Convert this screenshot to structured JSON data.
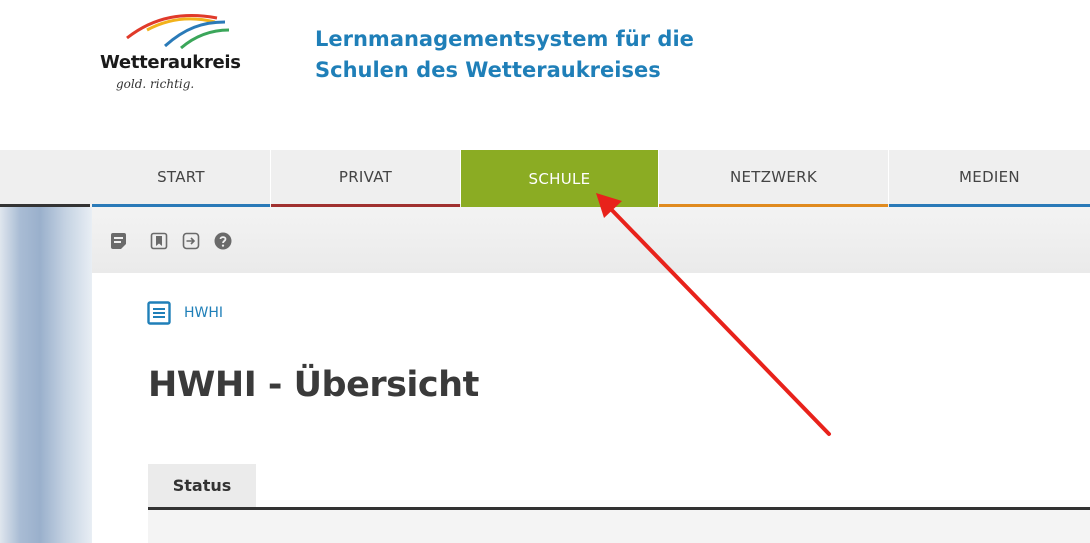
{
  "header": {
    "logo_name": "Wetteraukreis",
    "logo_tagline": "gold. richtig.",
    "site_title_line1": "Lernmanagementsystem für die",
    "site_title_line2": "Schulen des Wetteraukreises"
  },
  "nav": {
    "tabs": [
      {
        "label": "START",
        "accent": "#2a7ab8"
      },
      {
        "label": "PRIVAT",
        "accent": "#a0302f"
      },
      {
        "label": "SCHULE",
        "accent": "#8bac23",
        "active": true
      },
      {
        "label": "NETZWERK",
        "accent": "#e08a1e"
      },
      {
        "label": "MEDIEN",
        "accent": "#2a7ab8"
      }
    ]
  },
  "toolbar": {
    "icons": [
      "notes-icon",
      "bookmark-icon",
      "logout-icon",
      "help-icon"
    ]
  },
  "breadcrumb": {
    "label": "HWHI"
  },
  "page": {
    "title": "HWHI - Übersicht"
  },
  "tabs": {
    "status_label": "Status"
  },
  "annotation": {
    "arrow_color": "#e8221b"
  }
}
